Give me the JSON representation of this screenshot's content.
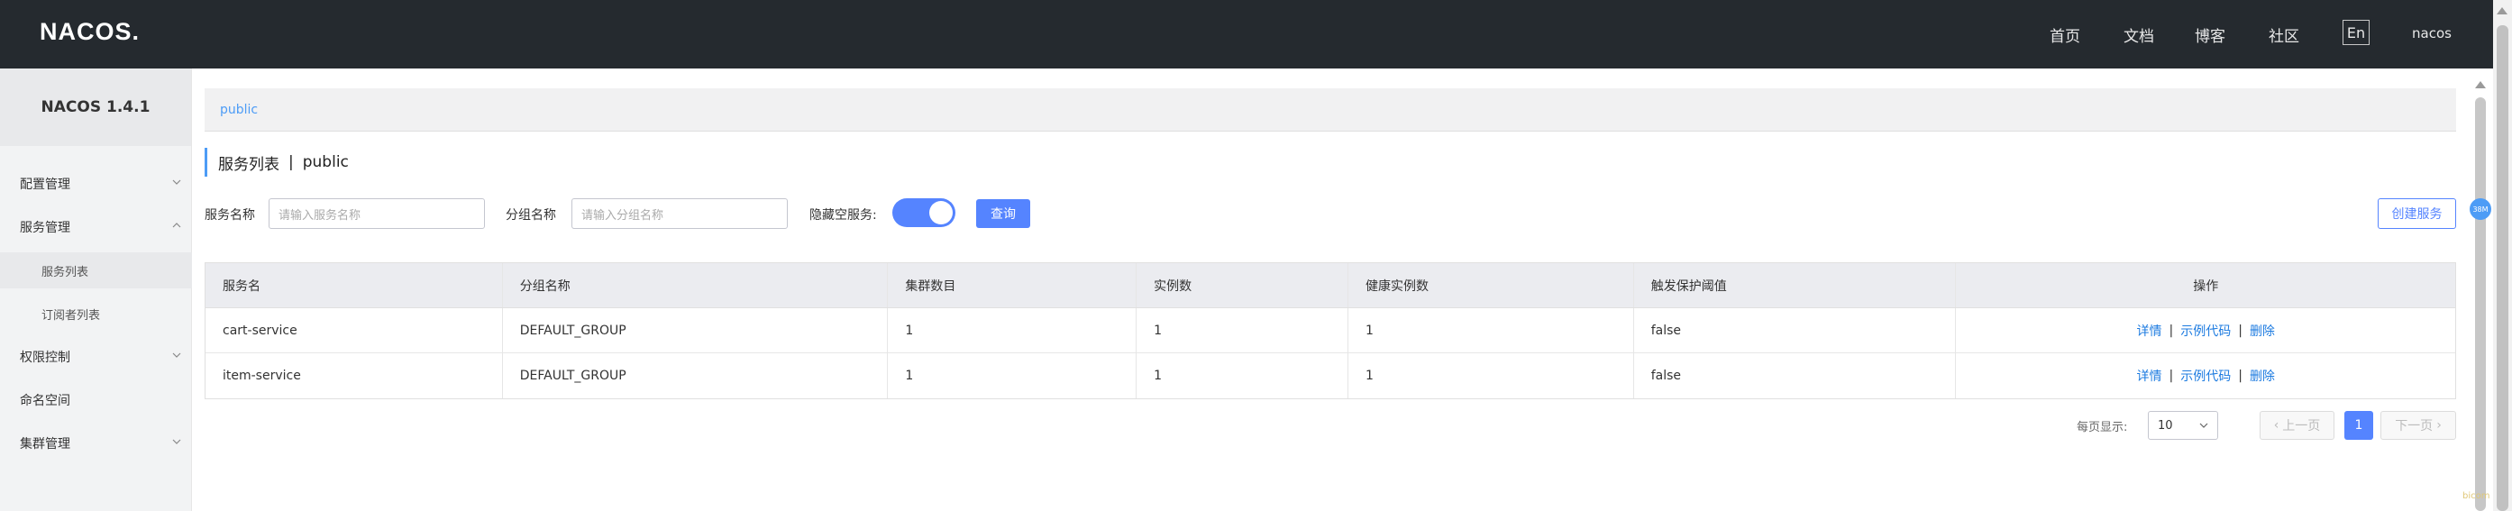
{
  "app": {
    "logo": "NACOS."
  },
  "header": {
    "nav": [
      "首页",
      "文档",
      "博客",
      "社区"
    ],
    "lang": "En",
    "user": "nacos"
  },
  "sidebar": {
    "title": "NACOS 1.4.1",
    "items": [
      {
        "label": "配置管理",
        "expandable": true
      },
      {
        "label": "服务管理",
        "expandable": true,
        "expanded": true
      },
      {
        "label": "服务列表",
        "sub": true,
        "active": true
      },
      {
        "label": "订阅者列表",
        "sub": true
      },
      {
        "label": "权限控制",
        "expandable": true
      },
      {
        "label": "命名空间"
      },
      {
        "label": "集群管理",
        "expandable": true
      }
    ]
  },
  "breadcrumb": "public",
  "page": {
    "title": "服务列表",
    "separator": "|",
    "namespace": "public"
  },
  "filters": {
    "service_label": "服务名称",
    "service_placeholder": "请输入服务名称",
    "group_label": "分组名称",
    "group_placeholder": "请输入分组名称",
    "hide_empty_label": "隐藏空服务:",
    "hide_empty": true,
    "search_button": "查询",
    "create_button": "创建服务"
  },
  "table": {
    "columns": [
      "服务名",
      "分组名称",
      "集群数目",
      "实例数",
      "健康实例数",
      "触发保护阈值",
      "操作"
    ],
    "rows": [
      {
        "name": "cart-service",
        "group": "DEFAULT_GROUP",
        "clusters": "1",
        "instances": "1",
        "healthy": "1",
        "threshold": "false"
      },
      {
        "name": "item-service",
        "group": "DEFAULT_GROUP",
        "clusters": "1",
        "instances": "1",
        "healthy": "1",
        "threshold": "false"
      }
    ],
    "actions": {
      "detail": "详情",
      "sample": "示例代码",
      "delete": "删除",
      "sep": "|"
    }
  },
  "pagination": {
    "per_page_label": "每页显示:",
    "per_page": "10",
    "prev": "上一页",
    "current": "1",
    "next": "下一页"
  },
  "misc": {
    "badge": "38M",
    "watermark": "bicom"
  },
  "colors": {
    "accent": "#5584ff",
    "link": "#1d7be0",
    "topbar": "#252a2f"
  }
}
